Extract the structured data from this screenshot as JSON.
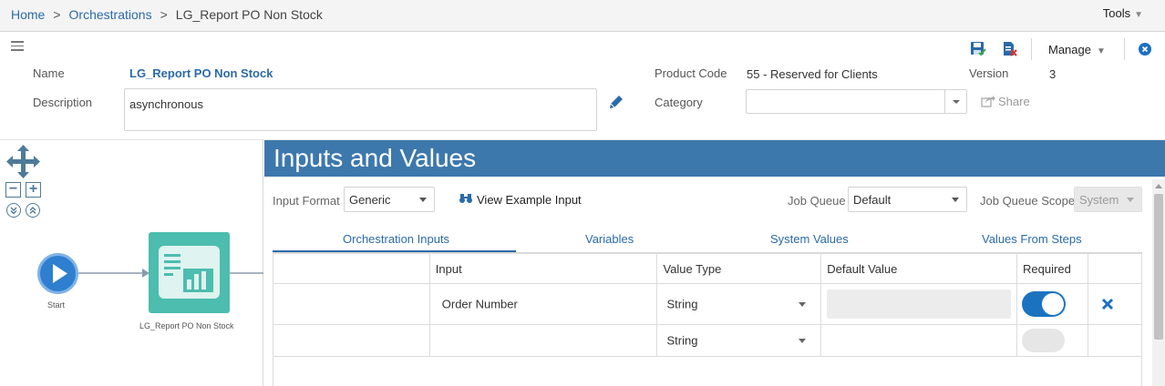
{
  "breadcrumb": {
    "home": "Home",
    "separator": ">",
    "orchestrations": "Orchestrations",
    "current": "LG_Report PO Non Stock"
  },
  "tools_label": "Tools",
  "header": {
    "name_label": "Name",
    "name_value": "LG_Report PO Non Stock",
    "description_label": "Description",
    "description_value": "asynchronous",
    "product_code_label": "Product Code",
    "product_code_value": "55 - Reserved for Clients",
    "version_label": "Version",
    "version_value": "3",
    "category_label": "Category",
    "category_value": "",
    "share_label": "Share",
    "manage_label": "Manage"
  },
  "canvas": {
    "start_label": "Start",
    "step_label": "LG_Report PO Non Stock"
  },
  "panel": {
    "title": "Inputs and Values",
    "input_format_label": "Input Format",
    "input_format_value": "Generic",
    "view_example_label": "View Example Input",
    "job_queue_label": "Job Queue",
    "job_queue_value": "Default",
    "job_queue_scope_label": "Job Queue Scope",
    "job_queue_scope_value": "System",
    "tabs": [
      {
        "label": "Orchestration Inputs",
        "active": true
      },
      {
        "label": "Variables",
        "active": false
      },
      {
        "label": "System Values",
        "active": false
      },
      {
        "label": "Values From Steps",
        "active": false
      }
    ],
    "columns": [
      "",
      "Input",
      "Value Type",
      "Default Value",
      "Required",
      ""
    ],
    "rows": [
      {
        "input": "Order Number",
        "value_type": "String",
        "default_value": "",
        "required": true
      },
      {
        "input": "",
        "value_type": "String",
        "default_value": "",
        "required": false
      }
    ]
  },
  "colors": {
    "accent": "#2b6aa8",
    "panel_header": "#3d78ac",
    "step_tile": "#4cbdae",
    "start_node": "#2e7fd0",
    "toggle_on": "#1b73c0"
  }
}
